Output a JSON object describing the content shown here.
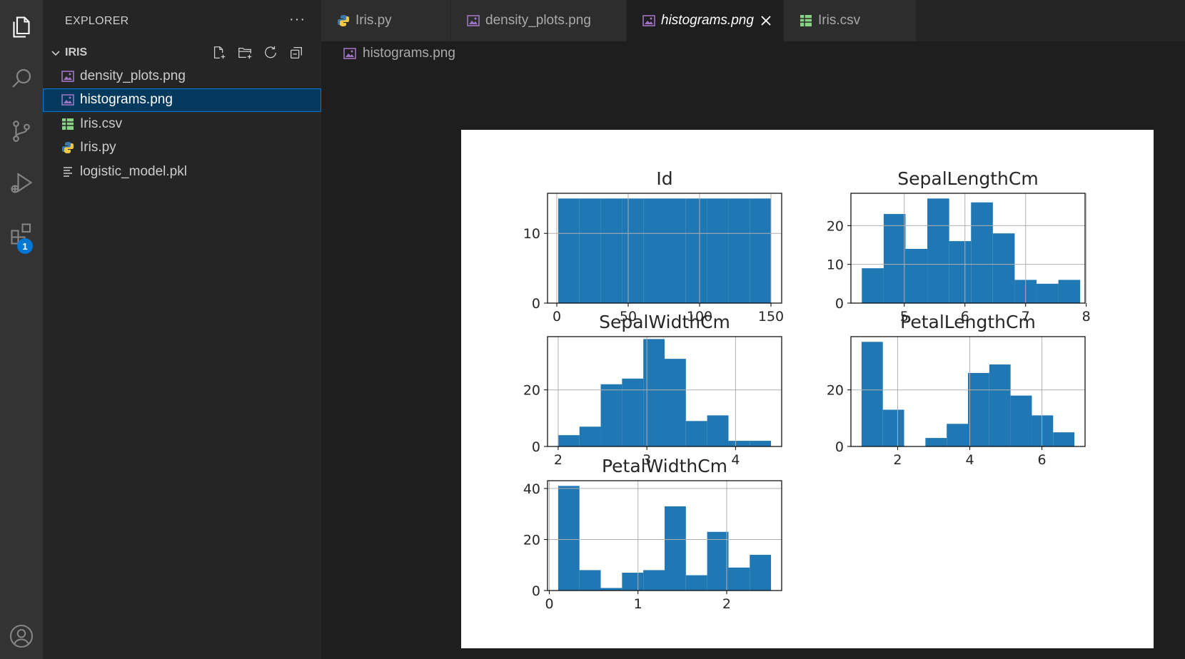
{
  "activity_bar": {
    "items": [
      {
        "name": "explorer",
        "icon": "files-icon"
      },
      {
        "name": "search",
        "icon": "search-icon"
      },
      {
        "name": "source-control",
        "icon": "source-control-icon"
      },
      {
        "name": "run-debug",
        "icon": "run-debug-icon"
      },
      {
        "name": "extensions",
        "icon": "extensions-icon",
        "badge": "1"
      }
    ],
    "bottom": {
      "name": "accounts",
      "icon": "account-icon"
    }
  },
  "sidebar": {
    "title": "EXPLORER",
    "more": "···",
    "folder": "IRIS",
    "files": [
      {
        "label": "density_plots.png",
        "type": "image"
      },
      {
        "label": "histograms.png",
        "type": "image",
        "selected": true
      },
      {
        "label": "Iris.csv",
        "type": "csv"
      },
      {
        "label": "Iris.py",
        "type": "python"
      },
      {
        "label": "logistic_model.pkl",
        "type": "text"
      }
    ]
  },
  "tabs": [
    {
      "label": "Iris.py",
      "type": "python"
    },
    {
      "label": "density_plots.png",
      "type": "image"
    },
    {
      "label": "histograms.png",
      "type": "image",
      "active": true
    },
    {
      "label": "Iris.csv",
      "type": "csv"
    }
  ],
  "breadcrumb": {
    "label": "histograms.png"
  },
  "colors": {
    "bar": "#1f77b4",
    "grid": "#b0b0b0",
    "selection": "#04395e",
    "accent": "#0078d4"
  },
  "chart_data": [
    {
      "type": "bar",
      "title": "Id",
      "xlim": [
        -6.5,
        157.5
      ],
      "ylim": [
        0,
        15.75
      ],
      "xticks": [
        0,
        50,
        100,
        150
      ],
      "yticks": [
        0,
        10
      ],
      "bin_edges": [
        1,
        15.9,
        30.8,
        45.7,
        60.6,
        75.5,
        90.4,
        105.3,
        120.2,
        135.1,
        150
      ],
      "values": [
        15,
        15,
        15,
        15,
        15,
        15,
        15,
        15,
        15,
        15
      ]
    },
    {
      "type": "bar",
      "title": "SepalLengthCm",
      "xlim": [
        4.12,
        7.98
      ],
      "ylim": [
        0,
        28.35
      ],
      "xticks": [
        5,
        6,
        7,
        8
      ],
      "yticks": [
        0,
        10,
        20
      ],
      "bin_edges": [
        4.3,
        4.66,
        5.02,
        5.38,
        5.74,
        6.1,
        6.46,
        6.82,
        7.18,
        7.54,
        7.9
      ],
      "values": [
        9,
        23,
        14,
        27,
        16,
        26,
        18,
        6,
        5,
        6
      ]
    },
    {
      "type": "bar",
      "title": "SepalWidthCm",
      "xlim": [
        1.88,
        4.52
      ],
      "ylim": [
        0,
        38.85
      ],
      "xticks": [
        2,
        3,
        4
      ],
      "yticks": [
        0,
        20
      ],
      "bin_edges": [
        2.0,
        2.24,
        2.48,
        2.72,
        2.96,
        3.2,
        3.44,
        3.68,
        3.92,
        4.16,
        4.4
      ],
      "values": [
        4,
        7,
        22,
        24,
        38,
        31,
        9,
        11,
        2,
        2
      ]
    },
    {
      "type": "bar",
      "title": "PetalLengthCm",
      "xlim": [
        0.705,
        7.195
      ],
      "ylim": [
        0,
        38.85
      ],
      "xticks": [
        2,
        4,
        6
      ],
      "yticks": [
        0,
        20
      ],
      "bin_edges": [
        1.0,
        1.59,
        2.18,
        2.77,
        3.36,
        3.95,
        4.54,
        5.13,
        5.72,
        6.31,
        6.9
      ],
      "values": [
        37,
        13,
        0,
        3,
        8,
        26,
        29,
        18,
        11,
        5
      ]
    },
    {
      "type": "bar",
      "title": "PetalWidthCm",
      "xlim": [
        -0.02,
        2.62
      ],
      "ylim": [
        0,
        43.05
      ],
      "xticks": [
        0,
        1,
        2
      ],
      "yticks": [
        0,
        20,
        40
      ],
      "bin_edges": [
        0.1,
        0.34,
        0.58,
        0.82,
        1.06,
        1.3,
        1.54,
        1.78,
        2.02,
        2.26,
        2.5
      ],
      "values": [
        41,
        8,
        1,
        7,
        8,
        33,
        6,
        23,
        9,
        14
      ]
    }
  ]
}
